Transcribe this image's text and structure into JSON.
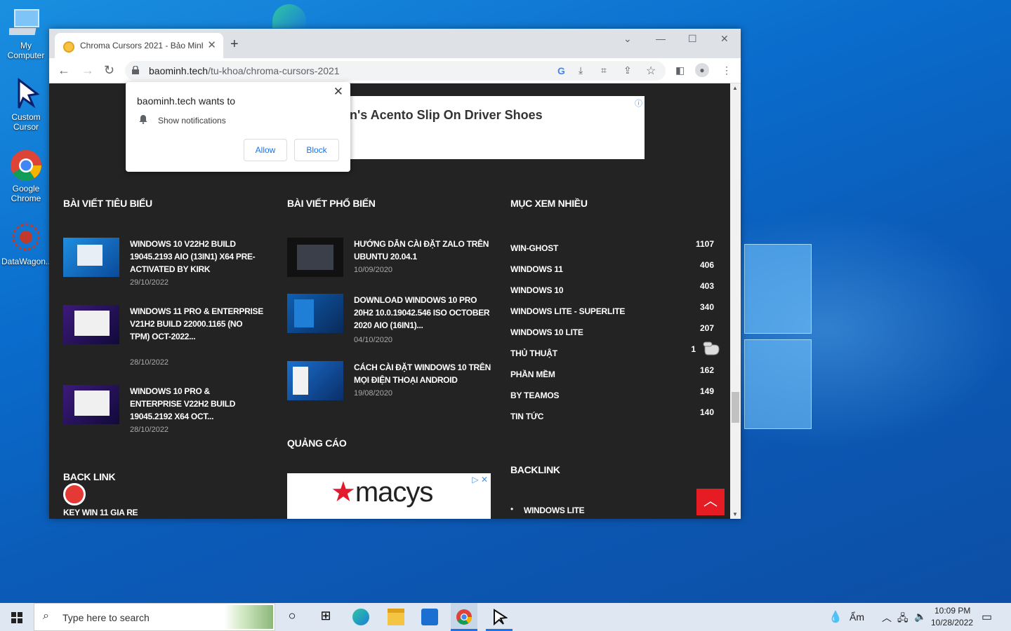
{
  "desktop": {
    "icons": [
      {
        "label": "My Computer"
      },
      {
        "label": "Custom Cursor"
      },
      {
        "label": "Google Chrome"
      },
      {
        "label": "DataWagon..."
      }
    ]
  },
  "browser": {
    "tab_title": "Chroma Cursors 2021 - Bảo Minh",
    "url_host": "baominh.tech",
    "url_path": "/tu-khoa/chroma-cursors-2021"
  },
  "notification": {
    "title": "baominh.tech wants to",
    "message": "Show notifications",
    "allow": "Allow",
    "block": "Block"
  },
  "page": {
    "top_ad_text": "n's Acento Slip On Driver Shoes",
    "col1_title": "BÀI VIẾT TIÊU BIỂU",
    "col2_title": "BÀI VIẾT PHỔ BIẾN",
    "col3_title": "MỤC XEM NHIỀU",
    "featured": [
      {
        "title": "WINDOWS 10 V22H2 BUILD 19045.2193 AIO (13IN1) X64 PRE-ACTIVATED BY KIRK",
        "date": "29/10/2022"
      },
      {
        "title": "WINDOWS 11 PRO & ENTERPRISE V21H2 BUILD 22000.1165 (NO TPM) OCT-2022...",
        "date": "28/10/2022"
      },
      {
        "title": "WINDOWS 10 PRO & ENTERPRISE V22H2 BUILD 19045.2192 X64 OCT...",
        "date": "28/10/2022"
      }
    ],
    "popular": [
      {
        "title": "HƯỚNG DẪN CÀI ĐẶT ZALO TRÊN UBUNTU 20.04.1",
        "date": "10/09/2020"
      },
      {
        "title": "DOWNLOAD WINDOWS 10 PRO 20H2 10.0.19042.546 ISO OCTOBER 2020 AIO (16IN1)...",
        "date": "04/10/2020"
      },
      {
        "title": "CÁCH CÀI ĐẶT WINDOWS 10 TRÊN MỌI ĐIỆN THOẠI ANDROID",
        "date": "19/08/2020"
      }
    ],
    "most_viewed": [
      {
        "name": "WIN-GHOST",
        "count": "1107"
      },
      {
        "name": "WINDOWS 11",
        "count": "406"
      },
      {
        "name": "WINDOWS 10",
        "count": "403"
      },
      {
        "name": "WINDOWS LITE - SUPERLITE",
        "count": "340"
      },
      {
        "name": "WINDOWS 10 LITE",
        "count": "207"
      },
      {
        "name": "THỦ THUẬT",
        "count": "1"
      },
      {
        "name": "PHẦN MỀM",
        "count": "162"
      },
      {
        "name": "BY TEAMOS",
        "count": "149"
      },
      {
        "name": "TIN TỨC",
        "count": "140"
      }
    ],
    "ads_title": "QUẢNG CÁO",
    "macys_logo": "macys",
    "backlink_left_title": "BACK LINK",
    "backlink_left_item": "KEY WIN 11 GIA RE",
    "backlink_right_title": "BACKLINK",
    "backlink_right_item": "WINDOWS LITE"
  },
  "taskbar": {
    "search_placeholder": "Type here to search",
    "weather": "Ẩm",
    "time": "10:09 PM",
    "date": "10/28/2022"
  },
  "colors": {
    "page_bg": "#232323",
    "accent_red": "#e51c23",
    "link_blue": "#1a73e8"
  }
}
